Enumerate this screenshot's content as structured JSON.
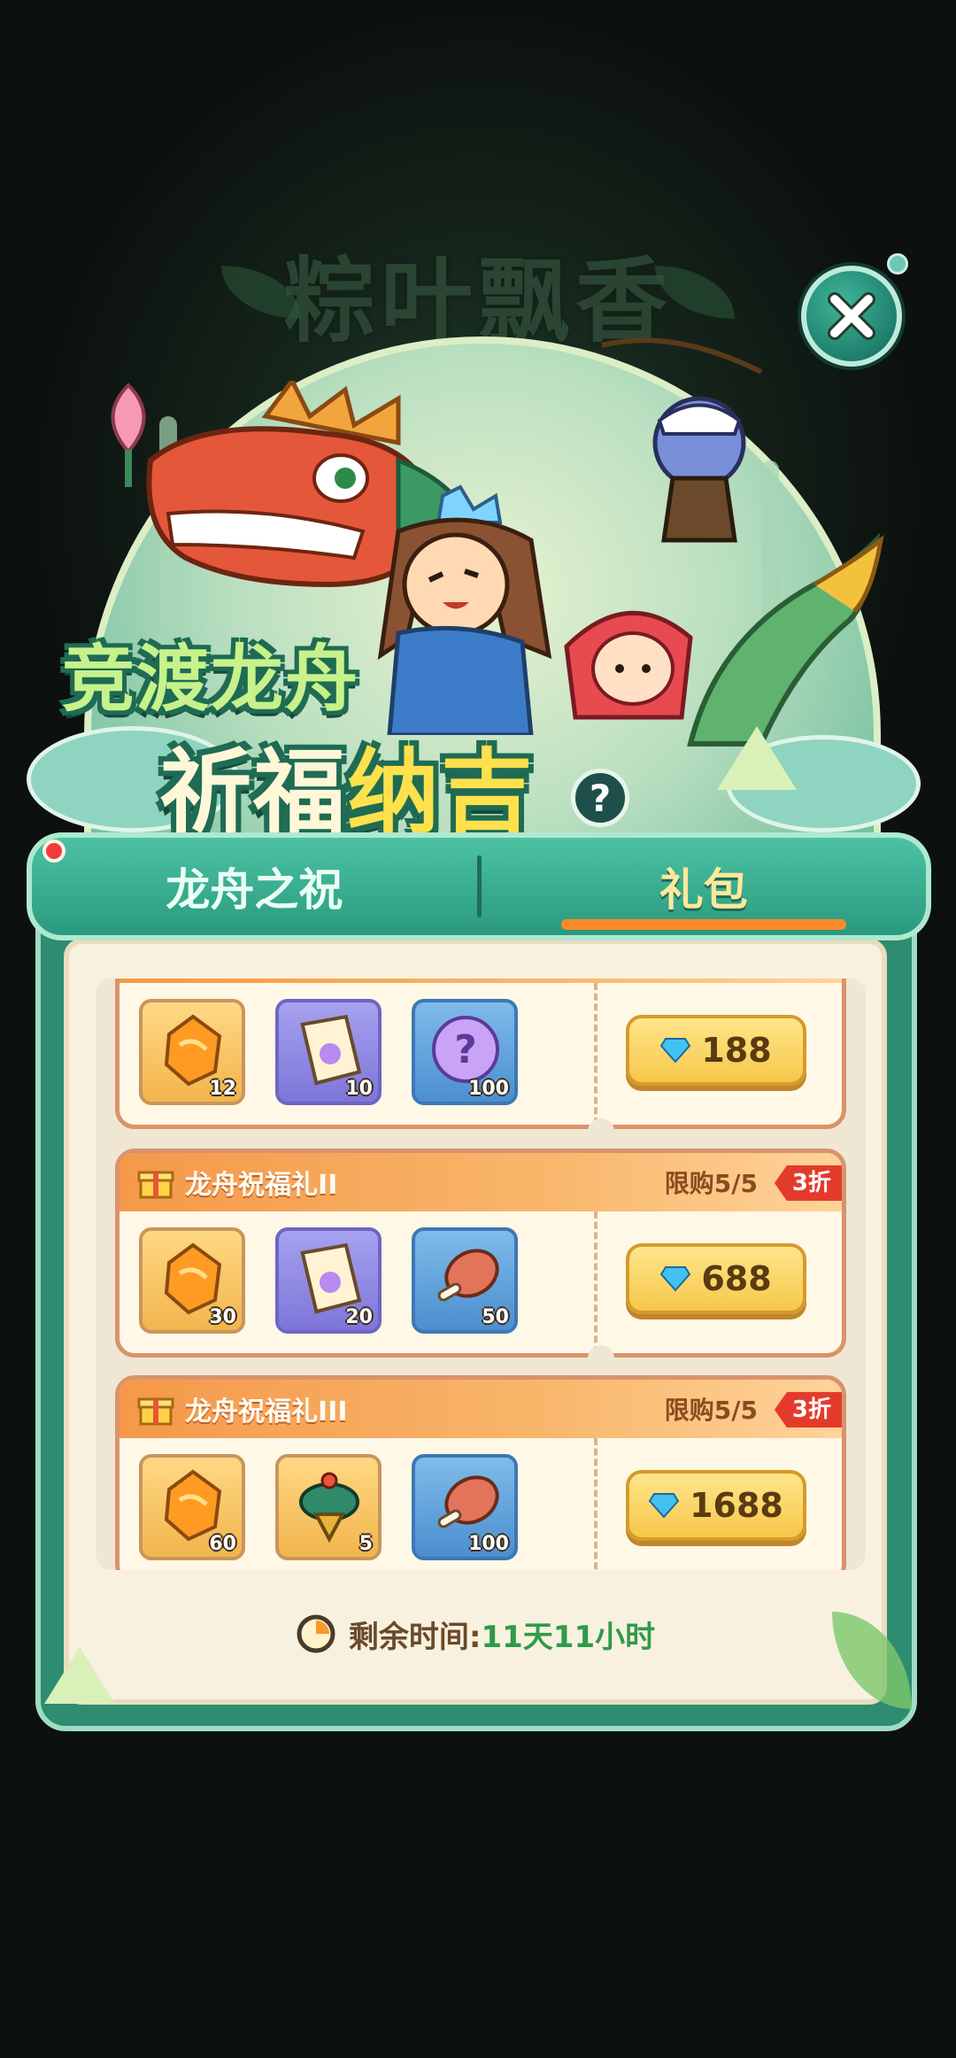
{
  "background": {
    "faint_title": "粽叶飘香"
  },
  "banner": {
    "title_line1": "竞渡龙舟",
    "title_line2_part1": "祈福",
    "title_line2_part2": "纳吉",
    "help_label": "?"
  },
  "tabs": [
    {
      "label": "龙舟之祝",
      "active": false
    },
    {
      "label": "礼包",
      "active": true
    }
  ],
  "packs": [
    {
      "name": "",
      "limit": "",
      "discount": "",
      "items": [
        {
          "icon": "gold-ore-icon",
          "qty": "12"
        },
        {
          "icon": "integral-scroll-icon",
          "qty": "10"
        },
        {
          "icon": "mystery-orb-icon",
          "qty": "100"
        }
      ],
      "price": "188"
    },
    {
      "name": "龙舟祝福礼II",
      "limit": "限购5/5",
      "discount": "3折",
      "items": [
        {
          "icon": "gold-ore-icon",
          "qty": "30"
        },
        {
          "icon": "integral-scroll-icon",
          "qty": "20"
        },
        {
          "icon": "meat-icon",
          "qty": "50"
        }
      ],
      "price": "688"
    },
    {
      "name": "龙舟祝福礼III",
      "limit": "限购5/5",
      "discount": "3折",
      "items": [
        {
          "icon": "gold-ore-icon",
          "qty": "60"
        },
        {
          "icon": "spinning-top-icon",
          "qty": "5"
        },
        {
          "icon": "meat-icon",
          "qty": "100"
        }
      ],
      "price": "1688"
    }
  ],
  "timer": {
    "label": "剩余时间:",
    "value": "11天11小时"
  },
  "colors": {
    "panel_green": "#2e8c70",
    "accent_orange": "#ff8a2a",
    "price_gold": "#f6c84a",
    "timer_green": "#2f9a4a",
    "discount_red": "#e33b2b"
  }
}
